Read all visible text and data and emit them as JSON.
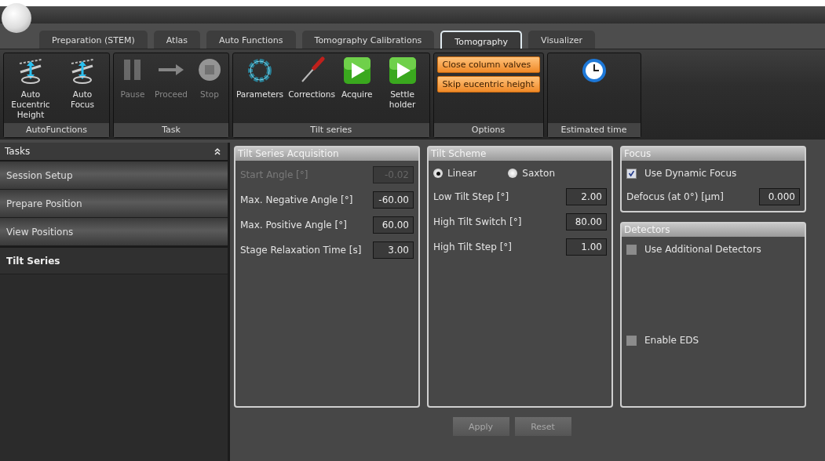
{
  "tabs": [
    {
      "label": "Preparation (STEM)",
      "selected": false
    },
    {
      "label": "Atlas",
      "selected": false
    },
    {
      "label": "Auto Functions",
      "selected": false
    },
    {
      "label": "Tomography Calibrations",
      "selected": false
    },
    {
      "label": "Tomography",
      "selected": true
    },
    {
      "label": "Visualizer",
      "selected": false
    }
  ],
  "ribbon": [
    {
      "label": "AutoFunctions",
      "items": [
        {
          "kind": "tool",
          "label": "Auto Eucentric Height",
          "disabled": false
        },
        {
          "kind": "tool",
          "label": "Auto Focus",
          "disabled": false
        }
      ]
    },
    {
      "label": "Task",
      "items": [
        {
          "kind": "tool",
          "label": "Pause",
          "disabled": true
        },
        {
          "kind": "tool",
          "label": "Proceed",
          "disabled": true
        },
        {
          "kind": "tool",
          "label": "Stop",
          "disabled": true
        }
      ]
    },
    {
      "label": "Tilt series",
      "items": [
        {
          "kind": "tool",
          "label": "Parameters",
          "disabled": false
        },
        {
          "kind": "tool",
          "label": "Corrections",
          "disabled": false
        },
        {
          "kind": "tool",
          "label": "Acquire",
          "disabled": false
        },
        {
          "kind": "tool",
          "label": "Settle holder",
          "disabled": false
        }
      ]
    },
    {
      "label": "Options",
      "items": [
        {
          "kind": "option",
          "label": "Close column valves",
          "disabled": false
        },
        {
          "kind": "option",
          "label": "Skip eucentric height",
          "disabled": false
        }
      ]
    },
    {
      "label": "Estimated time",
      "items": [
        {
          "kind": "tool",
          "disabled": false
        }
      ]
    }
  ],
  "sidebar": {
    "title": "Tasks",
    "expanded": true,
    "items": [
      {
        "label": "Session Setup",
        "selected": false
      },
      {
        "label": "Prepare Position",
        "selected": false
      },
      {
        "label": "View Positions",
        "selected": false
      },
      {
        "label": "Tilt Series",
        "selected": true
      }
    ]
  },
  "panels": [
    {
      "title": "Tilt Series Acquisition",
      "rows": [
        {
          "kind": "field",
          "label": "Start Angle [°]",
          "value": "-0.02",
          "disabled": true
        },
        {
          "kind": "field",
          "label": "Max. Negative Angle [°]",
          "value": "-60.00",
          "disabled": false
        },
        {
          "kind": "field",
          "label": "Max. Positive Angle [°]",
          "value": "60.00",
          "disabled": false
        },
        {
          "kind": "field",
          "label": "Stage Relaxation Time [s]",
          "value": "3.00",
          "disabled": false
        }
      ]
    },
    {
      "title": "Tilt Scheme",
      "rows": [
        {
          "kind": "radios",
          "options": [
            {
              "label": "Linear",
              "selected": true
            },
            {
              "label": "Saxton",
              "selected": false
            }
          ]
        },
        {
          "kind": "field",
          "label": "Low Tilt Step [°]",
          "value": "2.00",
          "disabled": false
        },
        {
          "kind": "field",
          "label": "High Tilt Switch [°]",
          "value": "80.00",
          "disabled": false
        },
        {
          "kind": "field",
          "label": "High Tilt Step [°]",
          "value": "1.00",
          "disabled": false
        }
      ]
    },
    {
      "title": "Focus",
      "rows": [
        {
          "kind": "checkbox",
          "label": "Use Dynamic Focus",
          "checked": true
        },
        {
          "kind": "field",
          "label": "Defocus (at 0°) [µm]",
          "value": "0.000",
          "disabled": false
        }
      ]
    },
    {
      "title": "Detectors",
      "rows": [
        {
          "kind": "checkbox",
          "label": "Use Additional Detectors",
          "checked": false
        },
        {
          "kind": "checkbox",
          "label": "Enable EDS",
          "checked": false
        }
      ]
    }
  ],
  "actions": [
    {
      "label": "Apply",
      "disabled": true
    },
    {
      "label": "Reset",
      "disabled": true
    }
  ]
}
